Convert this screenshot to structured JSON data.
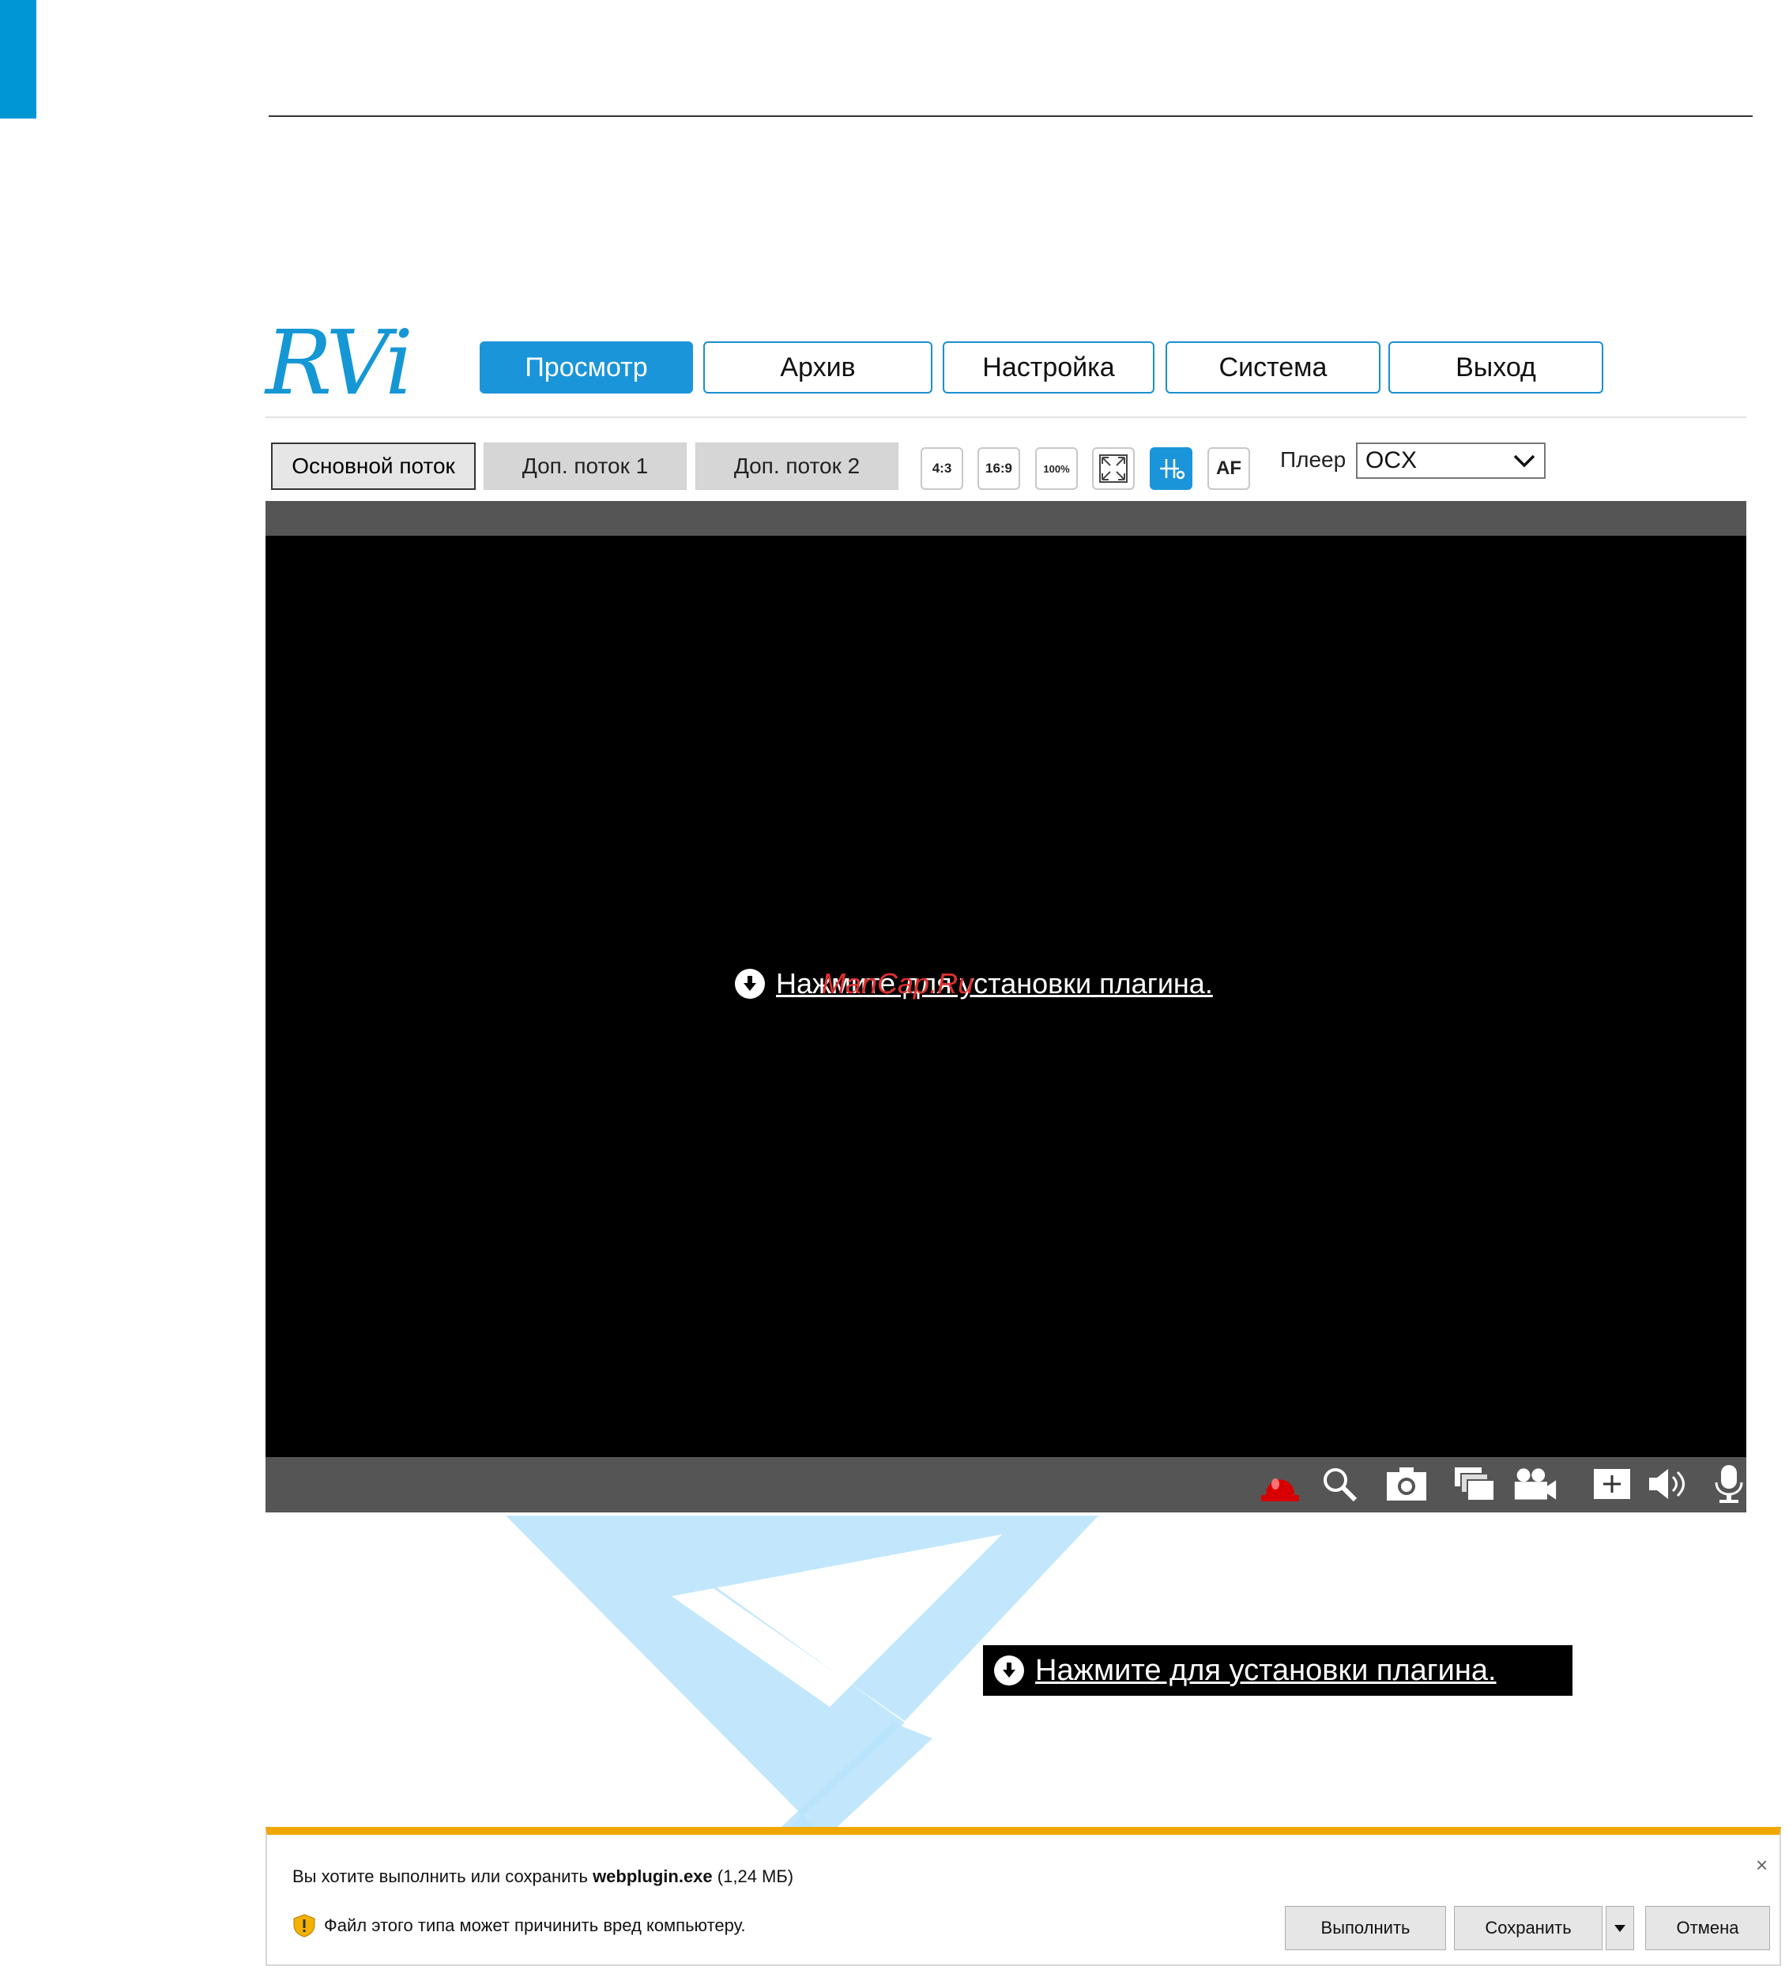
{
  "colors": {
    "accent": "#1b95d9",
    "video_bg": "#000000",
    "video_bar": "#555555",
    "download_bar_accent": "#f0a800",
    "record_red": "#d80000",
    "watermark": "#b7e3fb"
  },
  "header": {
    "logo_text": "RVi",
    "nav": [
      {
        "label": "Просмотр",
        "active": true
      },
      {
        "label": "Архив"
      },
      {
        "label": "Настройка"
      },
      {
        "label": "Система"
      },
      {
        "label": "Выход"
      }
    ]
  },
  "toolbar": {
    "streams": [
      {
        "label": "Основной поток",
        "active": true
      },
      {
        "label": "Доп. поток 1"
      },
      {
        "label": "Доп. поток 2"
      }
    ],
    "tools": [
      {
        "label": "4:3",
        "icon": "aspect-4-3-icon"
      },
      {
        "label": "16:9",
        "icon": "aspect-16-9-icon"
      },
      {
        "label": "100%",
        "icon": "zoom-100-icon"
      },
      {
        "label": "",
        "icon": "fullscreen-icon"
      },
      {
        "label": "",
        "icon": "ptz-control-icon",
        "active": true
      },
      {
        "label": "AF",
        "icon": "autofocus-icon"
      }
    ],
    "player_label": "Плеер",
    "player_value": "OCX"
  },
  "video": {
    "plugin_link": "Нажмите для установки плагина.",
    "overlay_mark": "ManCap.Ru",
    "controls": [
      "alarm-icon",
      "digital-zoom-icon",
      "snapshot-icon",
      "multi-window-icon",
      "record-icon",
      "add-icon",
      "audio-icon",
      "microphone-icon"
    ]
  },
  "zoomed_link": {
    "text": "Нажмите для установки плагина."
  },
  "download_bar": {
    "question_prefix": "Вы хотите выполнить или сохранить ",
    "file_name": "webplugin.exe",
    "file_size": "(1,24 МБ)",
    "warning": "Файл этого типа может причинить вред компьютеру.",
    "run_label": "Выполнить",
    "save_label": "Сохранить",
    "cancel_label": "Отмена",
    "close_glyph": "×"
  }
}
